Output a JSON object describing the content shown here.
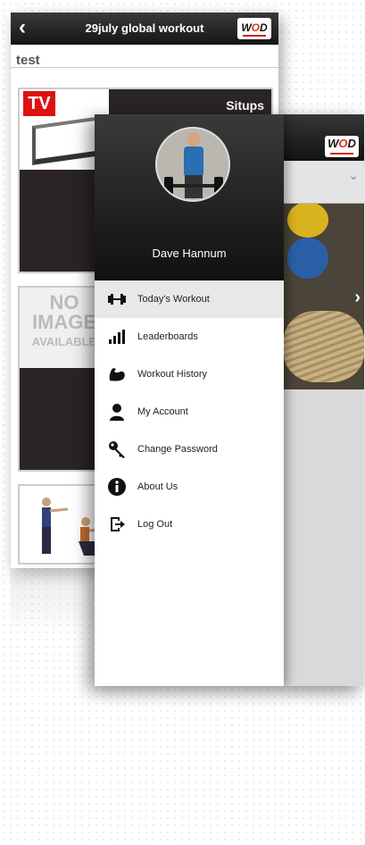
{
  "back_screen": {
    "title": "29july global workout",
    "subtitle": "test",
    "tiles": [
      {
        "badge": "TV",
        "title": "Situps"
      },
      {
        "no_image_lines": [
          "NO",
          "IMAGE",
          "AVAILABLE"
        ]
      },
      {
        "image": "squat-figures"
      }
    ],
    "logo": {
      "pre": "W",
      "o": "O",
      "post": "D"
    }
  },
  "front_screen": {
    "logo": {
      "pre": "W",
      "o": "O",
      "post": "D"
    },
    "user_name": "Dave Hannum",
    "menu": [
      {
        "label": "Today's Workout",
        "icon": "dumbbell-icon",
        "active": true
      },
      {
        "label": "Leaderboards",
        "icon": "bar-chart-icon"
      },
      {
        "label": "Workout History",
        "icon": "flexed-arm-icon"
      },
      {
        "label": "My Account",
        "icon": "user-icon"
      },
      {
        "label": "Change Password",
        "icon": "key-icon"
      },
      {
        "label": "About Us",
        "icon": "info-icon"
      },
      {
        "label": "Log Out",
        "icon": "logout-icon"
      }
    ]
  },
  "colors": {
    "header": "#1a1a1a",
    "brand_red": "#cc2211",
    "active_row": "#e8e8e8"
  }
}
